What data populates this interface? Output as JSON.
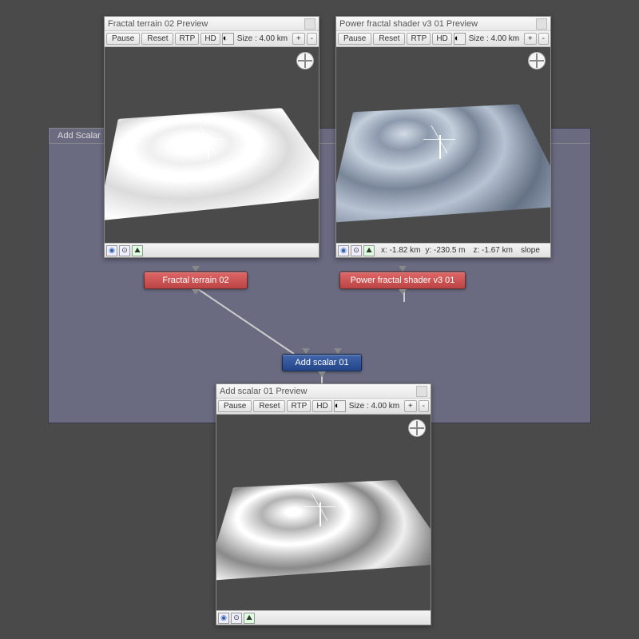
{
  "tab": {
    "label": "Add Scalar"
  },
  "preview1": {
    "title": "Fractal terrain 02 Preview",
    "pause": "Pause",
    "reset": "Reset",
    "rtp": "RTP",
    "hd": "HD",
    "size": "Size : 4.00 km",
    "plus": "+",
    "minus": "-"
  },
  "preview2": {
    "title": "Power fractal shader v3 01 Preview",
    "pause": "Pause",
    "reset": "Reset",
    "rtp": "RTP",
    "hd": "HD",
    "size": "Size : 4.00 km",
    "plus": "+",
    "minus": "-",
    "status_x": "x: -1.82 km",
    "status_y": "y: -230.5 m",
    "status_z": "z: -1.67 km",
    "status_slope": "slope"
  },
  "preview3": {
    "title": "Add scalar 01 Preview",
    "pause": "Pause",
    "reset": "Reset",
    "rtp": "RTP",
    "hd": "HD",
    "size": "Size : 4.00 km",
    "plus": "+",
    "minus": "-"
  },
  "nodes": {
    "fractal_terrain": "Fractal terrain 02",
    "power_fractal": "Power fractal shader v3 01",
    "add_scalar": "Add scalar 01"
  }
}
